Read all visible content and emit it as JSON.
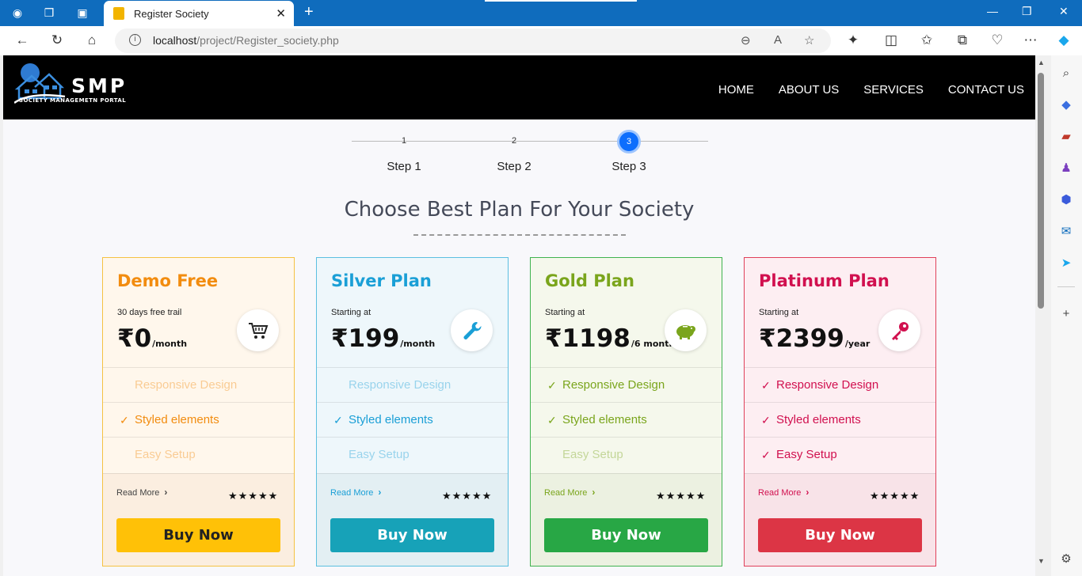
{
  "browser": {
    "tab_title": "Register Society",
    "url_host": "localhost",
    "url_path": "/project/Register_society.php",
    "read_aloud": "A"
  },
  "site": {
    "logo_title": "SMP",
    "logo_subtitle": "SOCIETY MANAGEMETN PORTAL",
    "nav": [
      "HOME",
      "ABOUT US",
      "SERVICES",
      "CONTACT US"
    ]
  },
  "stepper": {
    "steps": [
      {
        "num": "1",
        "label": "Step 1"
      },
      {
        "num": "2",
        "label": "Step 2"
      },
      {
        "num": "3",
        "label": "Step 3"
      }
    ],
    "active_step": 3
  },
  "heading": "Choose Best Plan For Your Society",
  "plans": [
    {
      "name": "Demo Free",
      "subtitle": "30 days free trail",
      "price": "₹0",
      "period": "/month",
      "icon": "cart-icon",
      "accent": "#f28c0f",
      "border": "#f5c242",
      "bg": "#fff7ec",
      "foot_bg": "#fbeee0",
      "button_color": "#ffc107",
      "button_text": "#222",
      "features": [
        {
          "text": "Responsive Design",
          "enabled": false
        },
        {
          "text": "Styled elements",
          "enabled": true
        },
        {
          "text": "Easy Setup",
          "enabled": false
        }
      ],
      "read_more": "Read More",
      "stars": "★★★★★",
      "rating": 5,
      "button": "Buy Now"
    },
    {
      "name": "Silver Plan",
      "subtitle": "Starting at",
      "price": "₹199",
      "period": "/month",
      "icon": "wrench-icon",
      "accent": "#1a9fd6",
      "border": "#5bbfe0",
      "bg": "#eef7fb",
      "foot_bg": "#e3eff3",
      "button_color": "#17a2b8",
      "button_text": "#fff",
      "features": [
        {
          "text": "Responsive Design",
          "enabled": false
        },
        {
          "text": "Styled elements",
          "enabled": true
        },
        {
          "text": "Easy Setup",
          "enabled": false
        }
      ],
      "read_more": "Read More",
      "stars": "★★★★★",
      "rating": 5,
      "button": "Buy Now"
    },
    {
      "name": "Gold Plan",
      "subtitle": "Starting at",
      "price": "₹1198",
      "period": "/6 month",
      "icon": "piggy-bank-icon",
      "accent": "#7aa51c",
      "border": "#3fb34f",
      "bg": "#f5f8ec",
      "foot_bg": "#ecf1e1",
      "button_color": "#28a745",
      "button_text": "#fff",
      "features": [
        {
          "text": "Responsive Design",
          "enabled": true
        },
        {
          "text": "Styled elements",
          "enabled": true
        },
        {
          "text": "Easy Setup",
          "enabled": false
        }
      ],
      "read_more": "Read More",
      "stars": "★★★★★",
      "rating": 5,
      "button": "Buy Now"
    },
    {
      "name": "Platinum Plan",
      "subtitle": "Starting at",
      "price": "₹2399",
      "period": "/year",
      "icon": "key-icon",
      "accent": "#d1104f",
      "border": "#e0405a",
      "bg": "#fdeef2",
      "foot_bg": "#f8e3e8",
      "button_color": "#dc3545",
      "button_text": "#fff",
      "features": [
        {
          "text": "Responsive Design",
          "enabled": true
        },
        {
          "text": "Styled elements",
          "enabled": true
        },
        {
          "text": "Easy Setup",
          "enabled": true
        }
      ],
      "read_more": "Read More",
      "stars": "★★★★★",
      "rating": 5,
      "button": "Buy Now"
    }
  ]
}
